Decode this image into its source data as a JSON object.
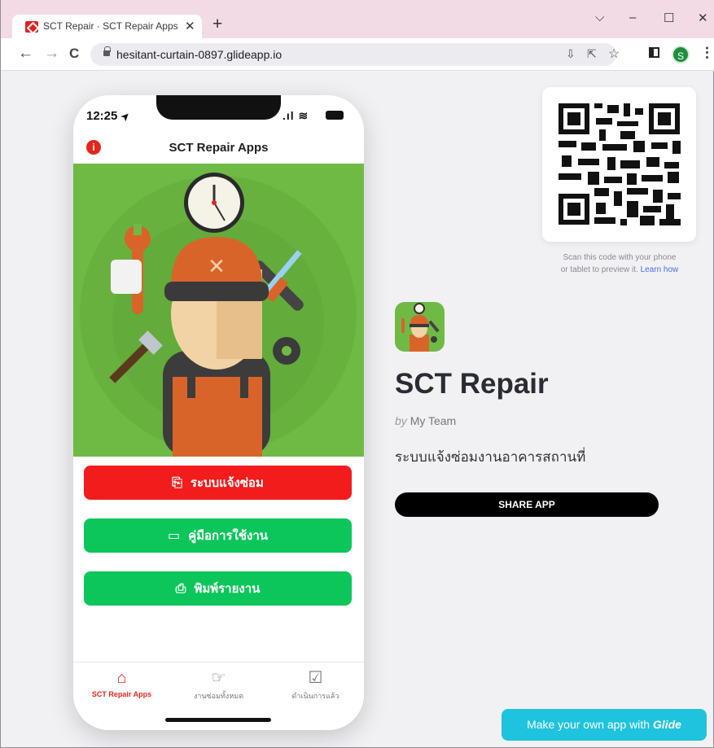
{
  "browser": {
    "tab_title": "SCT Repair · SCT Repair Apps · M",
    "tab_close": "✕",
    "new_tab": "+",
    "url": "hesitant-curtain-0897.glideapp.io",
    "profile_initial": "S",
    "window_controls": {
      "collapse": "⌵",
      "minimize": "–",
      "maximize": "☐",
      "close": "✕"
    }
  },
  "phone": {
    "time": "12:25",
    "location_glyph": "➤",
    "signal_wifi": ".ıl ≋",
    "info_glyph": "i",
    "app_title": "SCT Repair Apps",
    "buttons": [
      {
        "label": "ระบบแจ้งซ่อม",
        "icon": "repair-request-icon",
        "color": "#f21c1c"
      },
      {
        "label": "คู่มือการใช้งาน",
        "icon": "manual-icon",
        "color": "#0cc65b"
      },
      {
        "label": "พิมพ์รายงาน",
        "icon": "printer-icon",
        "color": "#0cc65b"
      }
    ],
    "nav": [
      {
        "label": "SCT Repair Apps",
        "active": true
      },
      {
        "label": "งานซ่อมทั้งหมด",
        "active": false
      },
      {
        "label": "ดำเนินการแล้ว",
        "active": false
      }
    ]
  },
  "qr": {
    "caption_line1": "Scan this code with your phone",
    "caption_line2": "or tablet to preview it.",
    "learn_link": "Learn how"
  },
  "app_info": {
    "name": "SCT Repair",
    "by_prefix": "by",
    "author": "My Team",
    "description": "ระบบแจ้งซ่อมงานอาคารสถานที่",
    "share_label": "SHARE APP"
  },
  "glide_cta": {
    "prefix": "Make your own app with",
    "brand": "Glide"
  },
  "colors": {
    "accent_red": "#e5261c",
    "accent_green": "#0cc65b",
    "hero_green": "#6fba45",
    "glide_blue": "#1fc3dd"
  }
}
